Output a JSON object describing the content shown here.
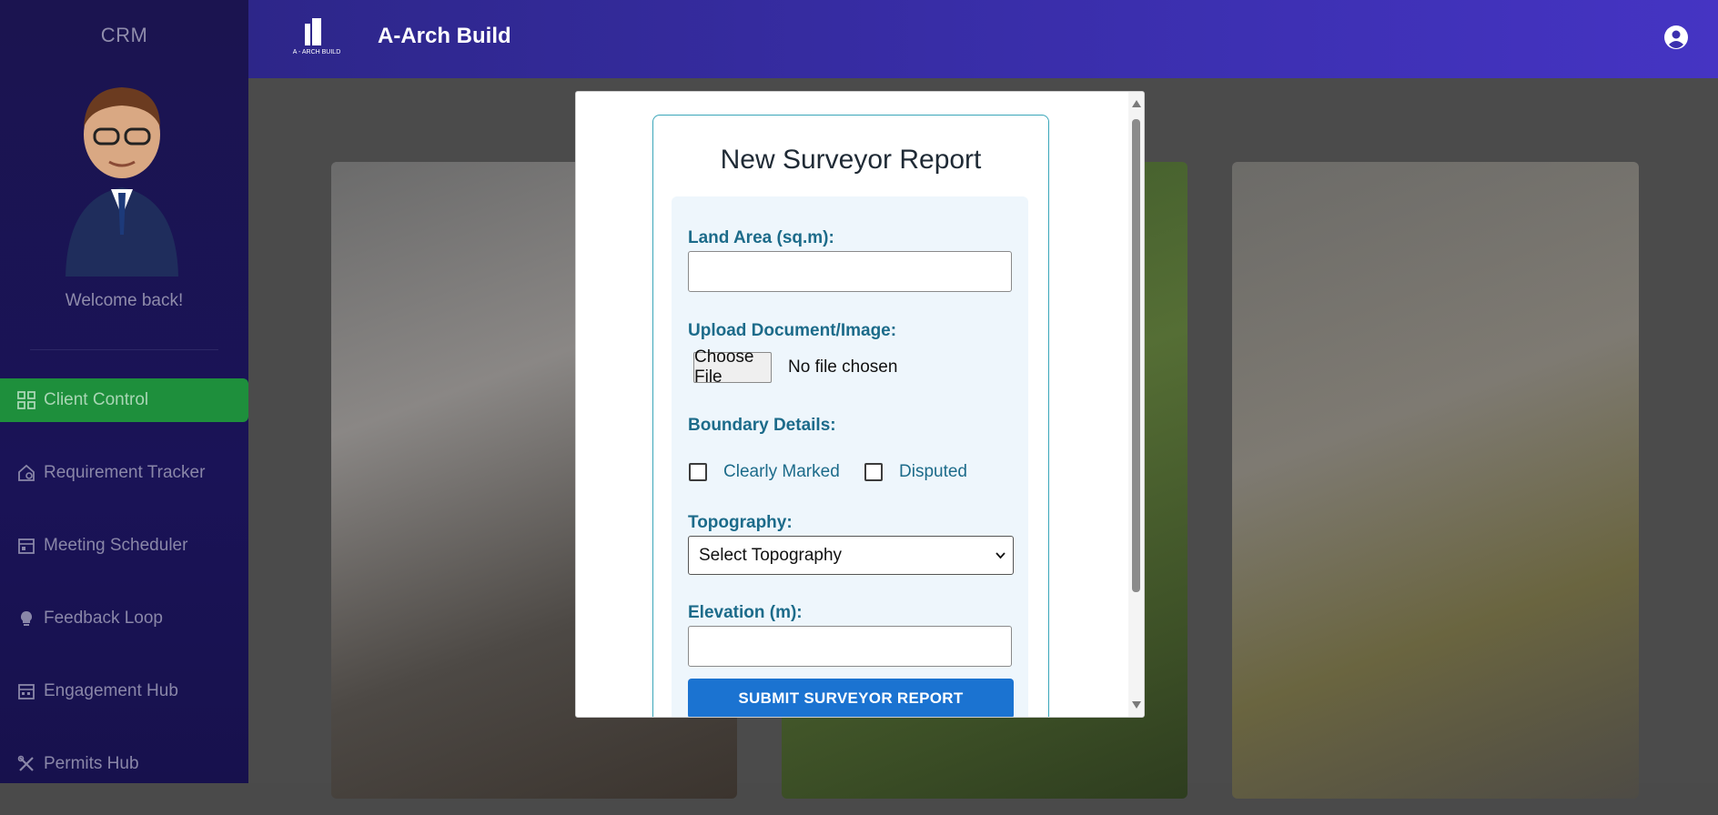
{
  "sidebar": {
    "app_name": "CRM",
    "welcome": "Welcome back!",
    "items": [
      {
        "label": "Client Control",
        "icon": "dashboard-icon"
      },
      {
        "label": "Requirement Tracker",
        "icon": "home-settings-icon"
      },
      {
        "label": "Meeting Scheduler",
        "icon": "calendar-icon"
      },
      {
        "label": "Feedback Loop",
        "icon": "lightbulb-icon"
      },
      {
        "label": "Engagement Hub",
        "icon": "calendar-grid-icon"
      },
      {
        "label": "Permits Hub",
        "icon": "tools-icon"
      }
    ]
  },
  "header": {
    "logo_text": "A - ARCH BUILD",
    "brand": "A-Arch Build",
    "user_icon": "user-circle-icon"
  },
  "modal": {
    "title": "New Surveyor Report",
    "land_area_label": "Land Area (sq.m):",
    "upload_label": "Upload Document/Image:",
    "choose_file": "Choose File",
    "no_file": "No file chosen",
    "boundary_label": "Boundary Details:",
    "boundary_options": [
      "Clearly Marked",
      "Disputed"
    ],
    "topography_label": "Topography:",
    "topography_selected": "Select Topography",
    "elevation_label": "Elevation (m):",
    "submit_label": "SUBMIT SURVEYOR REPORT"
  },
  "colors": {
    "sidebar_bg": "#1b1450",
    "active_item": "#1e8f3c",
    "header_start": "#2d2689",
    "header_end": "#4534c3",
    "form_border": "#3aa6b9",
    "label": "#1c6b8a",
    "submit_bg": "#1b73d1"
  }
}
